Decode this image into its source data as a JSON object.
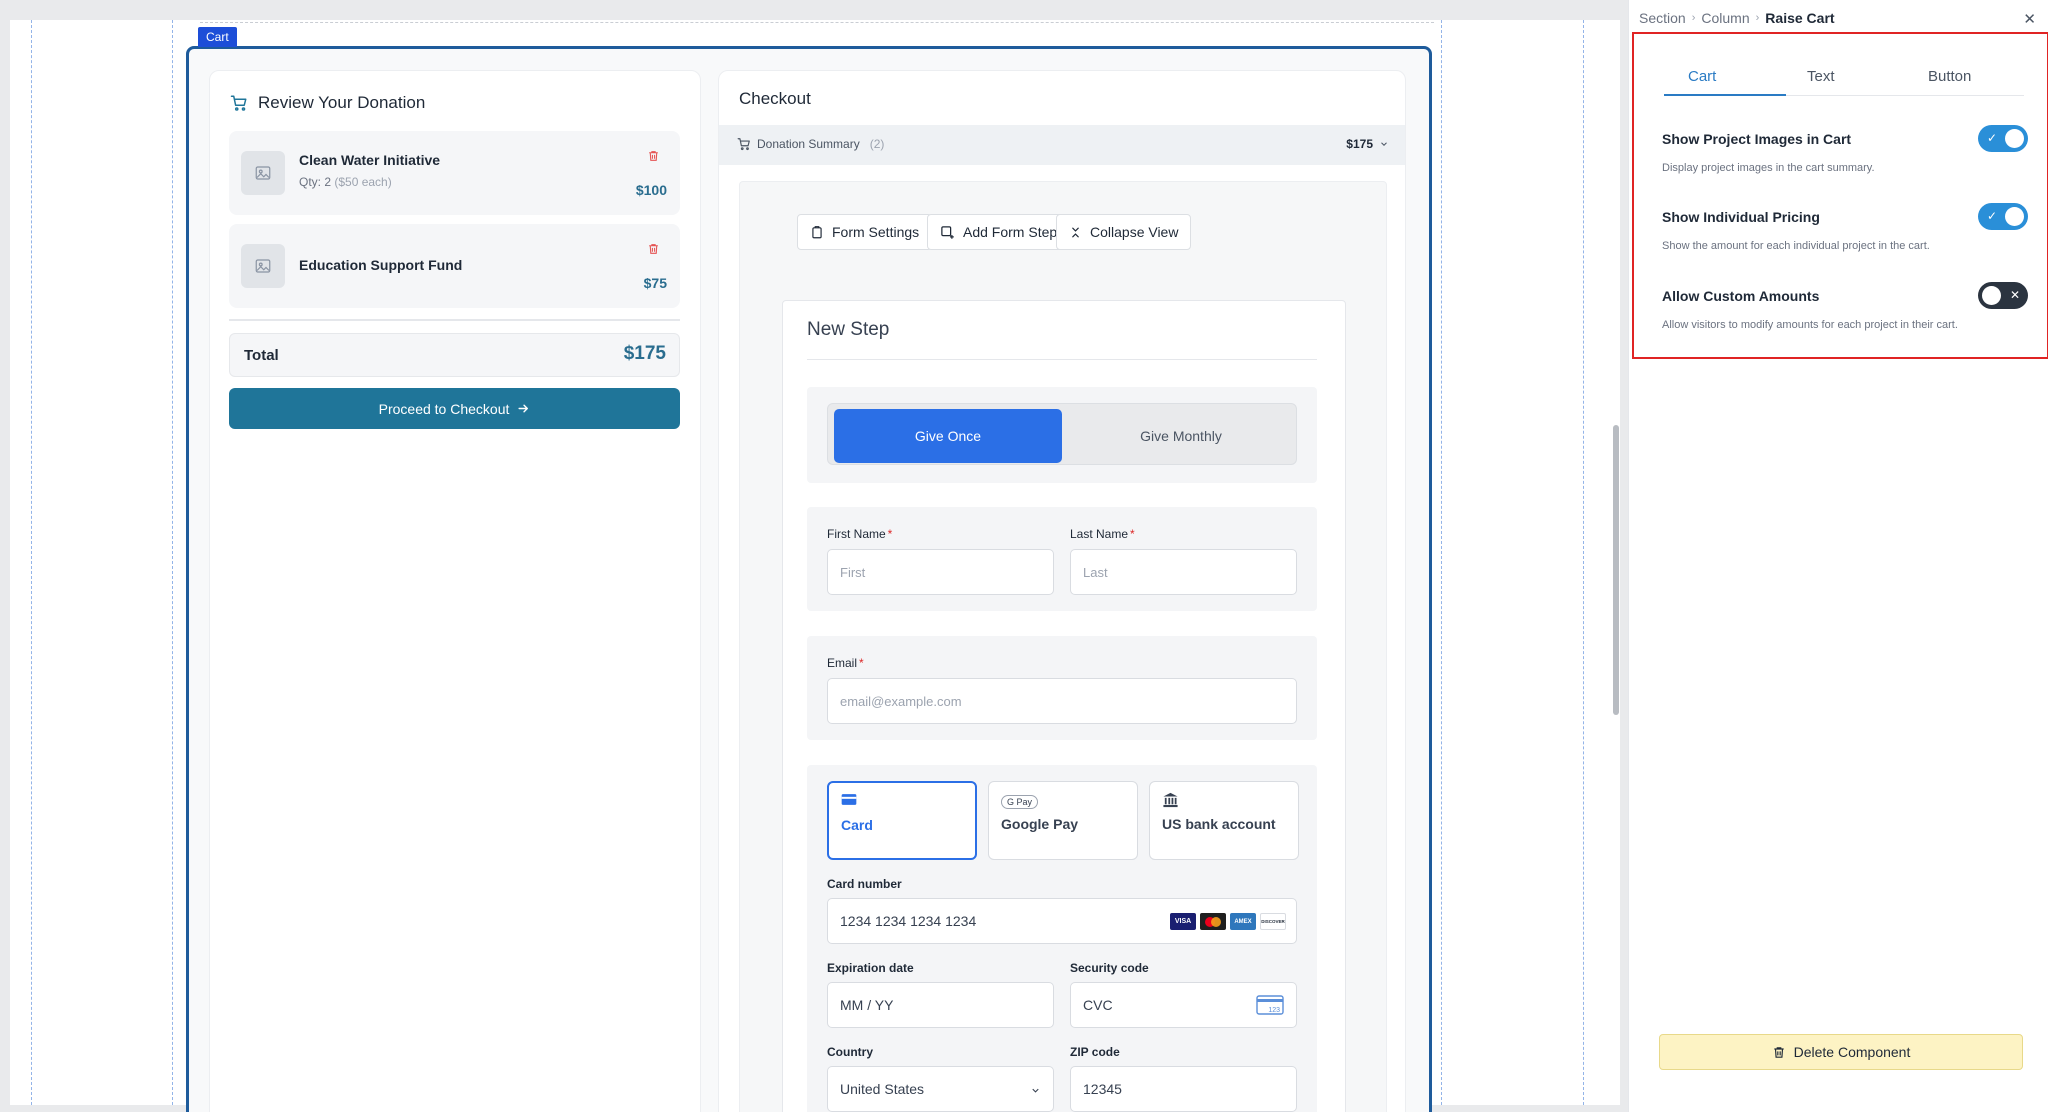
{
  "canvas": {
    "cart_tag": "Cart",
    "review": {
      "title": "Review Your Donation",
      "items": [
        {
          "name": "Clean Water Initiative",
          "qty": "Qty: 2",
          "each": "($50 each)",
          "price": "$100"
        },
        {
          "name": "Education Support Fund",
          "price": "$75"
        }
      ],
      "total_label": "Total",
      "total_value": "$175",
      "checkout_label": "Proceed to Checkout"
    },
    "checkout": {
      "title": "Checkout",
      "summary_label": "Donation Summary",
      "summary_count": "(2)",
      "summary_total": "$175",
      "toolbar": {
        "form_settings": "Form Settings",
        "add_step": "Add Form Step",
        "collapse": "Collapse View"
      },
      "step": {
        "title": "New Step",
        "give_once": "Give Once",
        "give_monthly": "Give Monthly",
        "first_name_label": "First Name",
        "first_name_placeholder": "First",
        "last_name_label": "Last Name",
        "last_name_placeholder": "Last",
        "required_mark": "*",
        "email_label": "Email",
        "email_placeholder": "email@example.com",
        "payment_options": [
          "Card",
          "Google Pay",
          "US bank account"
        ],
        "gpay_badge": "G Pay",
        "card_number_label": "Card number",
        "card_number_placeholder": "1234 1234 1234 1234",
        "card_brands": [
          "VISA",
          "MC",
          "AMEX",
          "DISCOVER"
        ],
        "expiration_label": "Expiration date",
        "expiration_placeholder": "MM / YY",
        "security_label": "Security code",
        "security_placeholder": "CVC",
        "cvc_badge": "123",
        "country_label": "Country",
        "country_value": "United States",
        "zip_label": "ZIP code",
        "zip_placeholder": "12345"
      }
    }
  },
  "props": {
    "breadcrumb": [
      "Section",
      "Column",
      "Raise Cart"
    ],
    "tabs": [
      "Cart",
      "Text",
      "Button"
    ],
    "active_tab": "Cart",
    "options": [
      {
        "title": "Show Project Images in Cart",
        "desc": "Display project images in the cart summary.",
        "enabled": true
      },
      {
        "title": "Show Individual Pricing",
        "desc": "Show the amount for each individual project in the cart.",
        "enabled": true
      },
      {
        "title": "Allow Custom Amounts",
        "desc": "Allow visitors to modify amounts for each project in their cart.",
        "enabled": false
      }
    ],
    "delete_label": "Delete Component"
  },
  "colors": {
    "accent": "#2b6fe6",
    "primary_button": "#1f7599",
    "price_text": "#2a6d8f",
    "toggle_on": "#2a8fd8",
    "toggle_off": "#2b3440",
    "highlight_border": "#e02424",
    "selection_border": "#1e5b9b",
    "delete_bg": "#fdf3c4"
  },
  "icons": [
    "cart-icon",
    "image-placeholder-icon",
    "trash-icon",
    "arrow-right-icon",
    "clipboard-icon",
    "add-step-icon",
    "collapse-icon",
    "chevron-down-icon",
    "credit-card-icon",
    "google-pay-icon",
    "bank-icon",
    "cvc-card-icon",
    "check-icon",
    "x-icon",
    "close-icon"
  ]
}
